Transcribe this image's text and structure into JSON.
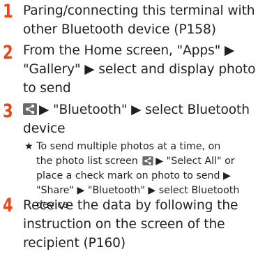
{
  "steps": [
    {
      "number": "1",
      "lines": [
        "Paring/connecting this terminal with",
        "other Bluetooth device (P158)"
      ]
    },
    {
      "number": "2",
      "lines": [
        "From the Home screen, \"Apps\" ▶",
        "\"Gallery\" ▶ select and display photo",
        "to send"
      ]
    },
    {
      "number": "3",
      "icon": "share-icon",
      "line1_text": "▶ \"Bluetooth\" ▶ select Bluetooth",
      "line2": "device",
      "note": {
        "line1": "★ To send multiple photos at a time, on",
        "line2_text": "the photo list screen",
        "line2_after": "▶ \"Select All\" or",
        "line3": "place a check mark on photo to send ▶",
        "line4": "\"Share\" ▶ \"Bluetooth\" ▶ select Bluetooth",
        "line5": "device"
      }
    },
    {
      "number": "4",
      "lines": [
        "Receive the data by following the",
        "instruction on the screen of the",
        "recipient (P160)"
      ]
    }
  ],
  "colors": {
    "step_number": "#e8491b",
    "text": "#231f20",
    "icon_bg": "#6b6b6b"
  }
}
